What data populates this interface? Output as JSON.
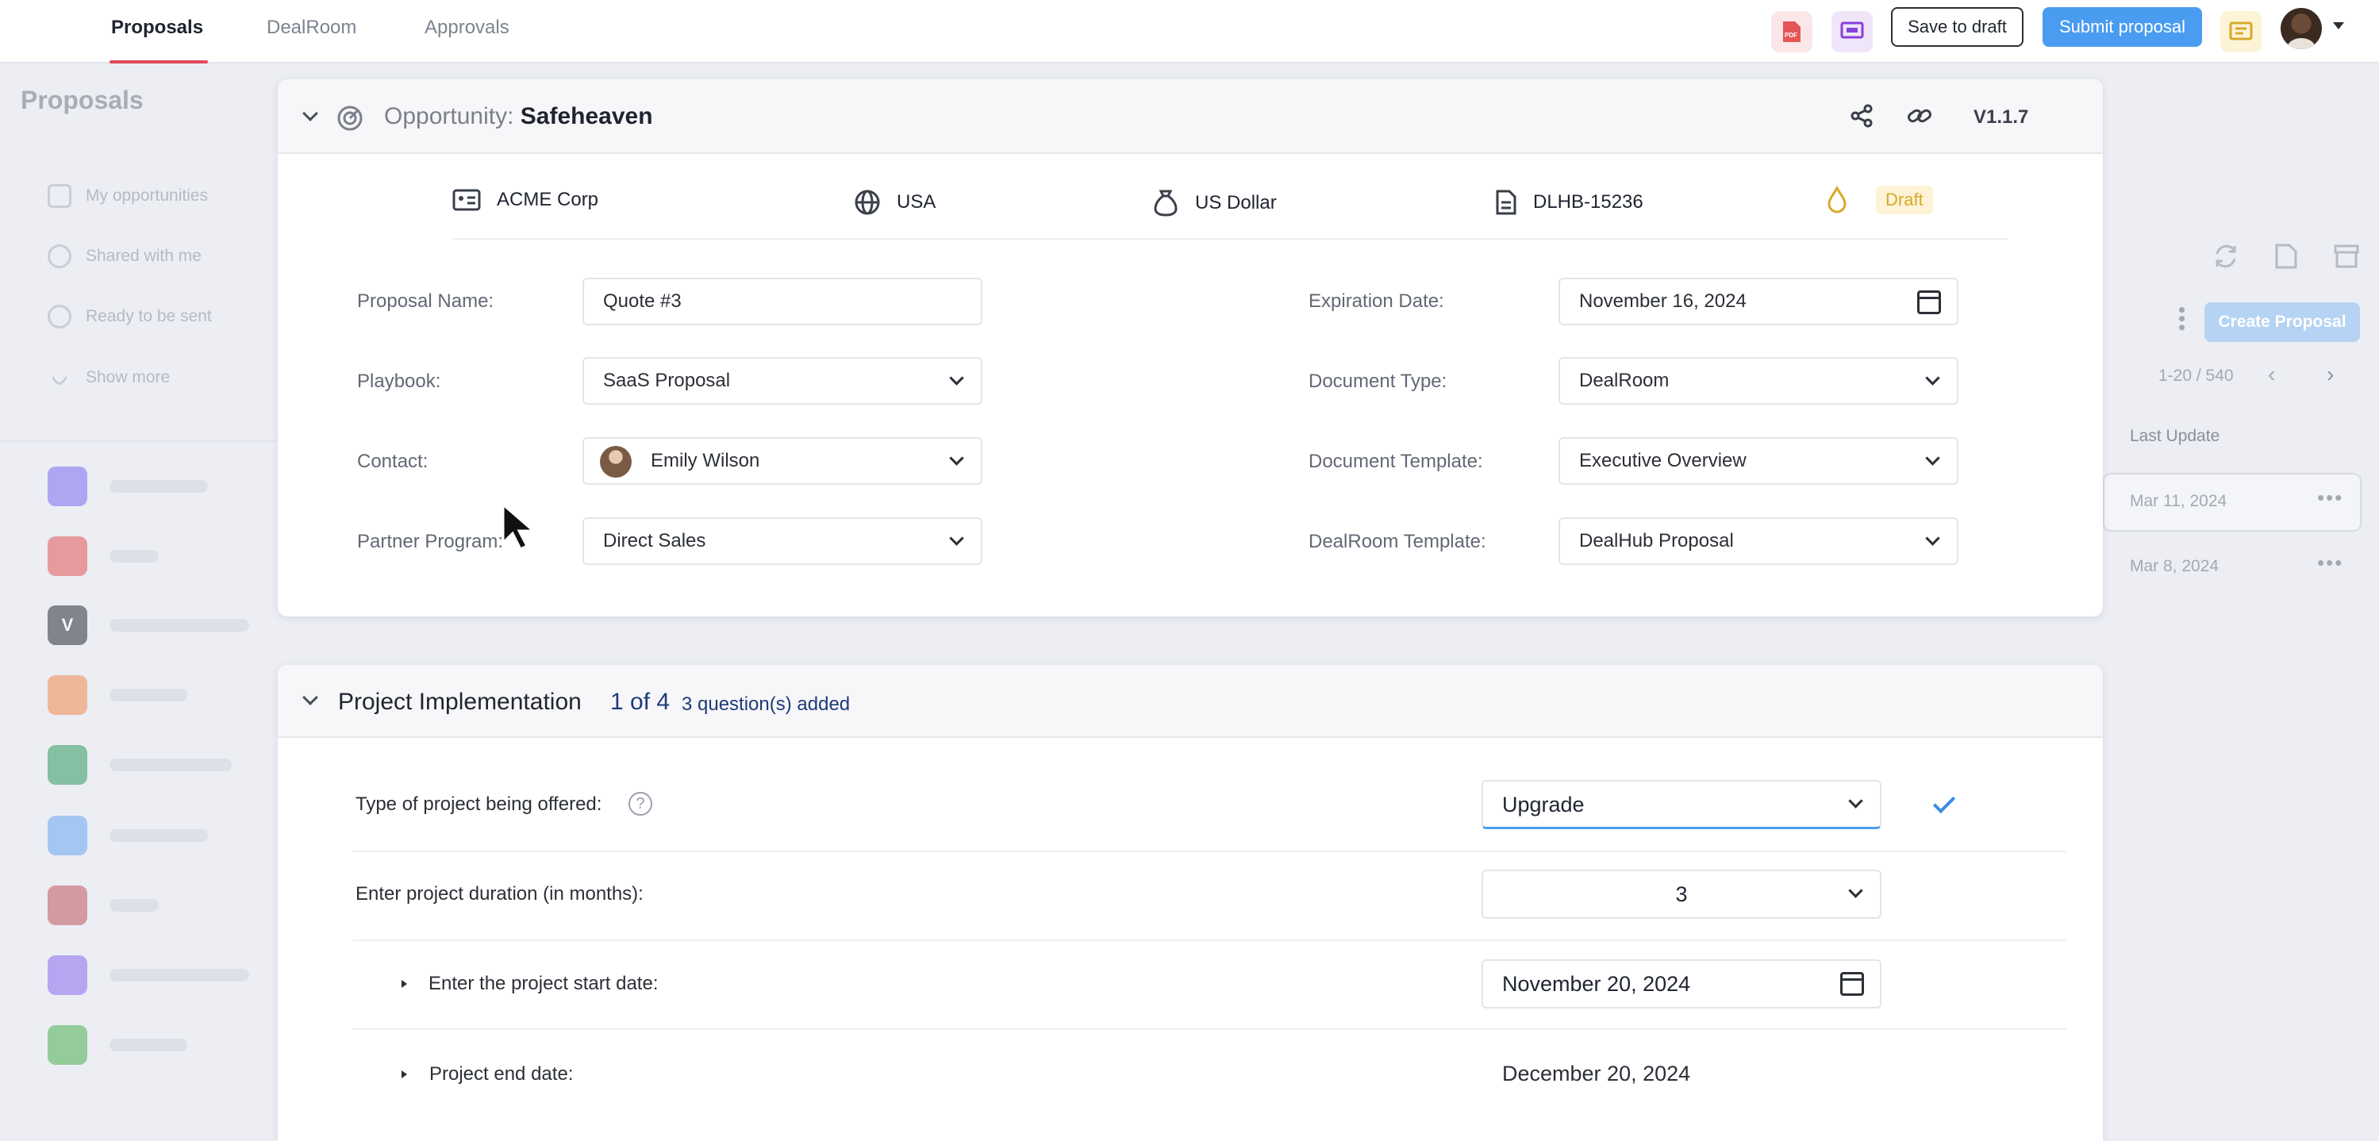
{
  "nav": {
    "tabs": [
      {
        "label": "Proposals",
        "active": true
      },
      {
        "label": "DealRoom",
        "active": false
      },
      {
        "label": "Approvals",
        "active": false
      }
    ],
    "save_draft": "Save to draft",
    "submit": "Submit proposal",
    "icons": [
      "pdf-icon",
      "presentation-icon",
      "notes-icon"
    ]
  },
  "background": {
    "title": "Proposals",
    "sidebar": [
      "My opportunities",
      "Shared with me",
      "Ready to be sent",
      "Show more"
    ],
    "apps": [
      "",
      "",
      "V",
      "",
      "",
      "",
      "",
      "",
      ""
    ],
    "create_proposal": "Create Proposal",
    "pagination": "1-20 / 540",
    "column_last_update": "Last Update",
    "rows": [
      "Mar 11, 2024",
      "Mar 8, 2024"
    ]
  },
  "opportunity": {
    "label": "Opportunity:",
    "name": "Safeheaven",
    "version": "V1.1.7",
    "company": "ACME Corp",
    "country": "USA",
    "currency": "US Dollar",
    "doc_id": "DLHB-15236",
    "status": "Draft",
    "fields": {
      "proposal_name": {
        "label": "Proposal Name:",
        "value": "Quote #3"
      },
      "playbook": {
        "label": "Playbook:",
        "value": "SaaS Proposal"
      },
      "contact": {
        "label": "Contact:",
        "value": "Emily Wilson"
      },
      "partner_program": {
        "label": "Partner Program:",
        "value": "Direct Sales"
      },
      "expiration_date": {
        "label": "Expiration Date:",
        "value": "November 16, 2024"
      },
      "document_type": {
        "label": "Document Type:",
        "value": "DealRoom"
      },
      "document_template": {
        "label": "Document Template:",
        "value": "Executive Overview"
      },
      "dealroom_template": {
        "label": "DealRoom Template:",
        "value": "DealHub Proposal"
      }
    }
  },
  "project": {
    "title": "Project Implementation",
    "count": "1 of 4",
    "added": "3 question(s) added",
    "questions": [
      {
        "label": "Type of project being offered:",
        "value": "Upgrade"
      },
      {
        "label": "Enter project duration (in months):",
        "value": "3"
      },
      {
        "label": "Enter the project start date:",
        "value": "November 20, 2024"
      },
      {
        "label": "Project end date:",
        "value": "December 20, 2024"
      }
    ]
  }
}
